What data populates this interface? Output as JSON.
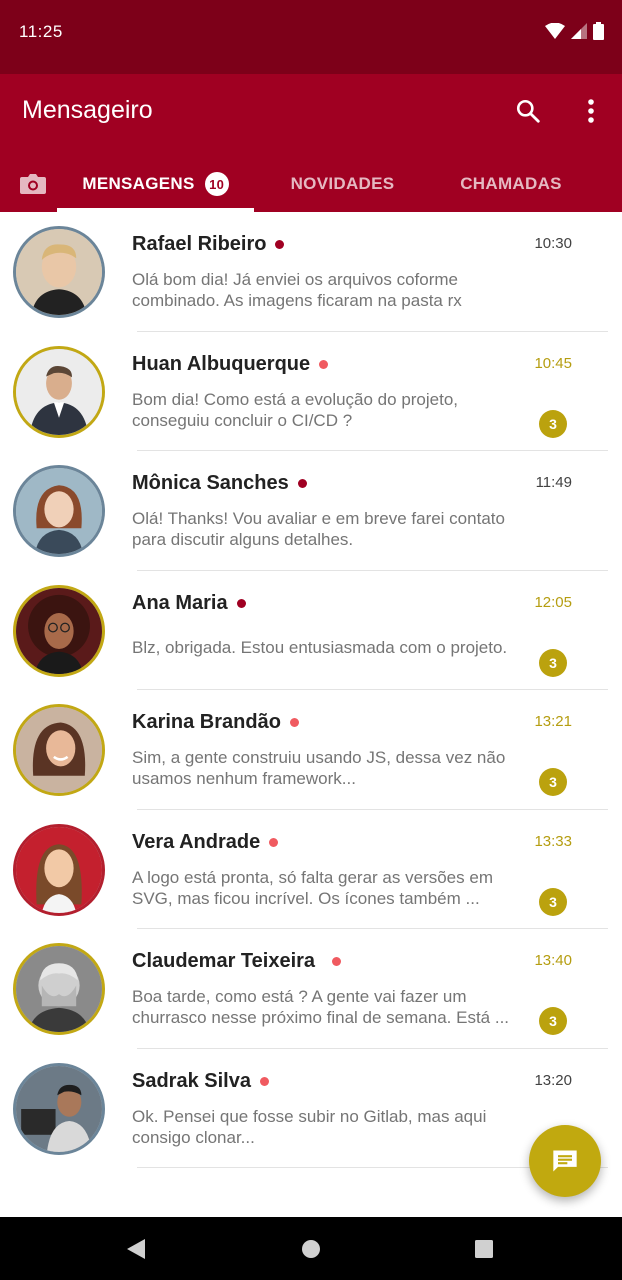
{
  "statusbar": {
    "time": "11:25"
  },
  "appbar": {
    "title": "Mensageiro",
    "search_icon": "search-icon",
    "more_icon": "more-vert-icon"
  },
  "tabs": [
    {
      "label": "MENSAGENS",
      "badge": "10",
      "active": true
    },
    {
      "label": "NOVIDADES",
      "active": false
    },
    {
      "label": "CHAMADAS",
      "active": false
    }
  ],
  "chats": [
    {
      "name": "Rafael Ribeiro",
      "line1": "Olá bom dia! Já enviei os arquivos coforme",
      "line2": "combinado. As imagens ficaram na pasta rx",
      "time": "10:30",
      "unread": ""
    },
    {
      "name": "Huan Albuquerque",
      "line1": "Bom dia! Como está a evolução do projeto,",
      "line2": "conseguiu concluir o CI/CD ?",
      "time": "10:45",
      "unread": "3"
    },
    {
      "name": "Mônica Sanches",
      "line1": "Olá! Thanks! Vou avaliar e em breve farei contato",
      "line2": "para discutir alguns detalhes.",
      "time": "11:49",
      "unread": ""
    },
    {
      "name": "Ana Maria",
      "line1": "Blz, obrigada. Estou entusiasmada com o projeto.",
      "line2": "",
      "time": "12:05",
      "unread": "3"
    },
    {
      "name": "Karina Brandão",
      "line1": "Sim, a gente construiu usando JS, dessa vez não",
      "line2": "usamos nenhum framework...",
      "time": "13:21",
      "unread": "3"
    },
    {
      "name": "Vera Andrade",
      "line1": "A logo está pronta, só falta gerar as versões em",
      "line2": "SVG, mas ficou incrível. Os ícones também ...",
      "time": "13:33",
      "unread": "3"
    },
    {
      "name": "Claudemar Teixeira",
      "line1": "Boa tarde, como está ? A gente vai fazer um",
      "line2": "churrasco nesse próximo final de semana. Está ...",
      "time": "13:40",
      "unread": "3"
    },
    {
      "name": "Sadrak Silva",
      "line1": "Ok. Pensei que fosse subir no Gitlab, mas aqui",
      "line2": "consigo clonar...",
      "time": "13:20",
      "unread": ""
    }
  ],
  "colors": {
    "statusbar": "#7d0019",
    "appbar": "#a00022",
    "accent": "#c1a90f"
  },
  "fab": {
    "icon": "message-icon"
  },
  "navbar": {
    "icons": [
      "back-icon",
      "home-icon",
      "recents-icon"
    ]
  }
}
